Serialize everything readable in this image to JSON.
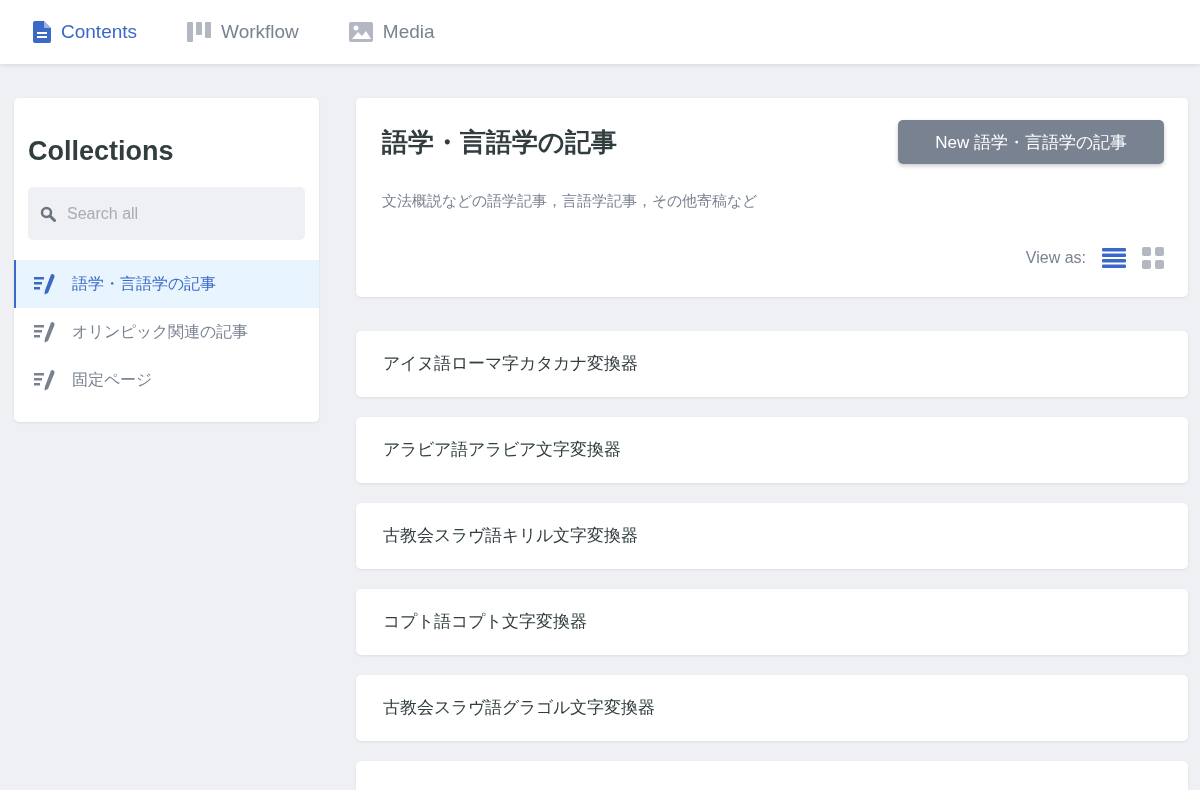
{
  "nav": {
    "tabs": [
      {
        "label": "Contents",
        "kind": "doc",
        "selected": true
      },
      {
        "label": "Workflow",
        "kind": "board",
        "selected": false
      },
      {
        "label": "Media",
        "kind": "image",
        "selected": false
      }
    ]
  },
  "sidebar": {
    "title": "Collections",
    "search": {
      "placeholder": "Search all"
    },
    "items": [
      {
        "label": "語学・言語学の記事",
        "selected": true
      },
      {
        "label": "オリンピック関連の記事",
        "selected": false
      },
      {
        "label": "固定ページ",
        "selected": false
      }
    ]
  },
  "collection": {
    "title": "語学・言語学の記事",
    "new_button": "New 語学・言語学の記事",
    "description": "文法概説などの語学記事，言語学記事，その他寄稿など",
    "view_as": {
      "label": "View as:",
      "options": [
        {
          "kind": "list",
          "selected": true
        },
        {
          "kind": "grid",
          "selected": false
        }
      ]
    }
  },
  "entries": [
    "アイヌ語ローマ字カタカナ変換器",
    "アラビア語アラビア文字変換器",
    "古教会スラヴ語キリル文字変換器",
    "コプト語コプト文字変換器",
    "古教会スラヴ語グラゴル文字変換器"
  ]
}
